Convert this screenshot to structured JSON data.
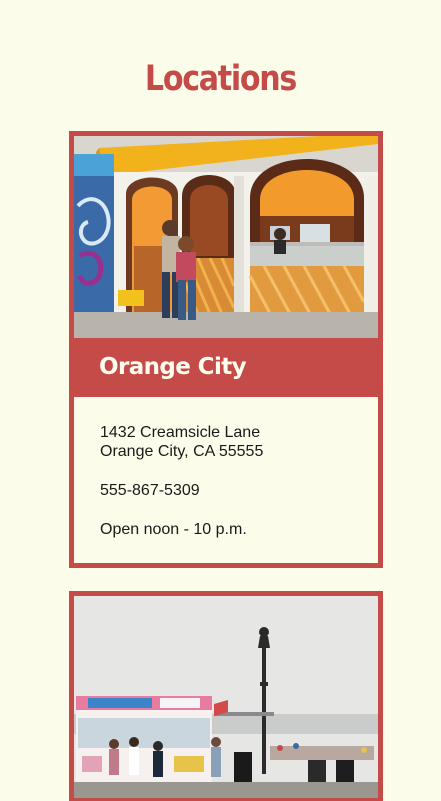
{
  "page": {
    "title": "Locations"
  },
  "locations": [
    {
      "name": "Orange City",
      "address_line1": "1432 Creamsicle Lane",
      "address_line2": "Orange City, CA 55555",
      "phone": "555-867-5309",
      "hours": "Open noon - 10 p.m."
    }
  ],
  "colors": {
    "background": "#fbfcea",
    "accent": "#c44b48",
    "header_text": "#fffdf0"
  }
}
